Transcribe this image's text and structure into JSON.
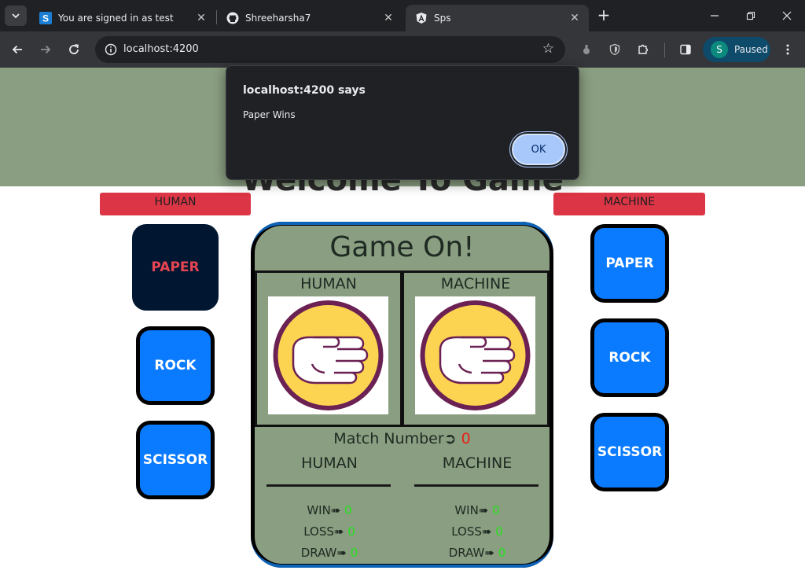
{
  "browser": {
    "tabs": [
      {
        "title": "You are signed in as test",
        "icon": "s-brand-icon",
        "active": false
      },
      {
        "title": "Shreeharsha7",
        "icon": "github-icon",
        "active": false
      },
      {
        "title": "Sps",
        "icon": "angular-icon",
        "active": true
      }
    ],
    "url": "localhost:4200",
    "profile": {
      "initial": "S",
      "status": "Paused"
    },
    "colors": {
      "tabstrip": "#202124",
      "toolbar": "#35363a",
      "profile_bg": "#0e4a6a"
    }
  },
  "page": {
    "welcome_title": "Welcome To Game",
    "human_label": "HUMAN",
    "machine_label": "MACHINE",
    "human_choices": [
      {
        "label": "PAPER",
        "selected": true
      },
      {
        "label": "ROCK",
        "selected": false
      },
      {
        "label": "SCISSOR",
        "selected": false
      }
    ],
    "machine_choices": [
      {
        "label": "PAPER"
      },
      {
        "label": "ROCK"
      },
      {
        "label": "SCISSOR"
      }
    ],
    "board": {
      "title": "Game On!",
      "human_header": "HUMAN",
      "machine_header": "MACHINE",
      "human_hand": "paper-hand-icon",
      "machine_hand": "paper-hand-icon",
      "match_label": "Match Number➲",
      "match_number": "0",
      "human_score": {
        "title": "HUMAN",
        "win_label": "WIN➠",
        "win": "0",
        "loss_label": "LOSS➠",
        "loss": "0",
        "draw_label": "DRAW➠",
        "draw": "0"
      },
      "machine_score": {
        "title": "MACHINE",
        "win_label": "WIN➠",
        "win": "0",
        "loss_label": "LOSS➠",
        "loss": "0",
        "draw_label": "DRAW➠",
        "draw": "0"
      }
    },
    "colors": {
      "banner": "#8a9e81",
      "badge": "#dc3545",
      "choice": "#0a7bff",
      "selected": "#011631",
      "score_value": "#22e11a",
      "match_value": "#e8201a"
    }
  },
  "dialog": {
    "title": "localhost:4200 says",
    "message": "Paper Wins",
    "ok_label": "OK"
  }
}
